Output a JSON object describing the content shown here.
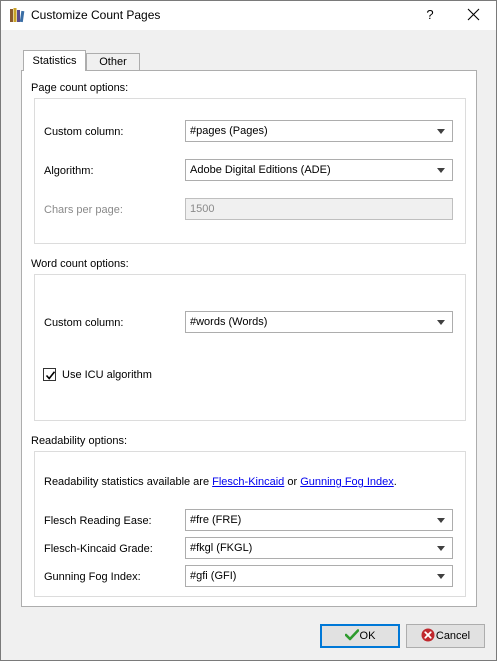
{
  "window": {
    "title": "Customize Count Pages",
    "help_label": "?"
  },
  "tabs": [
    {
      "label": "Statistics",
      "selected": true
    },
    {
      "label": "Other",
      "selected": false
    }
  ],
  "page_count": {
    "section_label": "Page count options:",
    "custom_column_label": "Custom column:",
    "custom_column_value": "#pages (Pages)",
    "algorithm_label": "Algorithm:",
    "algorithm_value": "Adobe Digital Editions (ADE)",
    "chars_per_page_label": "Chars per page:",
    "chars_per_page_value": "1500"
  },
  "word_count": {
    "section_label": "Word count options:",
    "custom_column_label": "Custom column:",
    "custom_column_value": "#words (Words)",
    "icu_label": "Use ICU algorithm",
    "icu_checked": true
  },
  "readability": {
    "section_label": "Readability options:",
    "info_prefix": "Readability statistics available are ",
    "link_flesch": "Flesch-Kincaid",
    "info_or": " or ",
    "link_gunning": "Gunning Fog Index",
    "info_suffix": ".",
    "fre_label": "Flesch Reading Ease:",
    "fre_value": "#fre (FRE)",
    "fkgl_label": "Flesch-Kincaid Grade:",
    "fkgl_value": "#fkgl (FKGL)",
    "gfi_label": "Gunning Fog Index:",
    "gfi_value": "#gfi (GFI)"
  },
  "buttons": {
    "ok_label": "OK",
    "cancel_label": "Cancel"
  },
  "colors": {
    "ok_icon": "#2e9b2e",
    "cancel_icon": "#c0282d",
    "link": "#0000ee"
  }
}
